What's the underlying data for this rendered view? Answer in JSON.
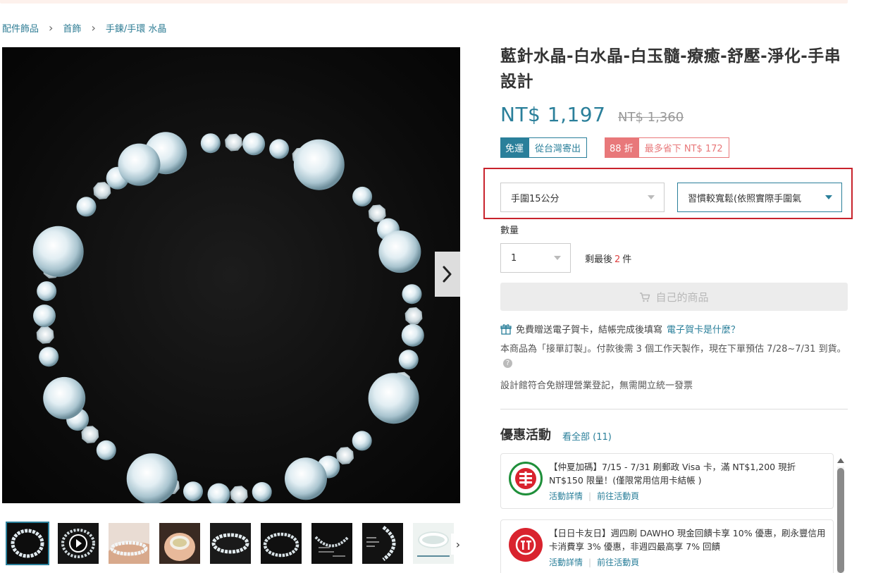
{
  "breadcrumb": [
    "配件飾品",
    "首飾",
    "手鍊/手環 水晶"
  ],
  "product": {
    "title": "藍針水晶-白水晶-白玉髓-療癒-舒壓-淨化-手串設計",
    "price": "NT$ 1,197",
    "original_price": "NT$ 1,360"
  },
  "tags": {
    "shipping_a": "免運",
    "shipping_b": "從台灣寄出",
    "discount_a": "88 折",
    "discount_b": "最多省下 NT$ 172"
  },
  "variants": {
    "size": "手圍15公分",
    "fit": "習慣較寬鬆(依照實際手圍氣"
  },
  "quantity": {
    "label": "數量",
    "value": "1",
    "stock_prefix": "剩最後",
    "stock_count": "2",
    "stock_suffix": "件"
  },
  "buy_button": "自己的商品",
  "gift": {
    "text": "免費贈送電子賀卡，結帳完成後填寫",
    "link": "電子賀卡是什麼？"
  },
  "notes": {
    "made_to_order": "本商品為「接單訂製」。付款後需 3 個工作天製作，現在下單預估 7/28~7/31 到貨。",
    "invoice": "設計館符合免辦理營業登記，無需開立統一發票"
  },
  "promotions": {
    "title": "優惠活動",
    "view_all": "看全部 (11)",
    "items": [
      {
        "text": "【仲夏加碼】7/15 - 7/31 刷郵政 Visa 卡，滿 NT$1,200 現折 NT$150 限量！(僅限常用信用卡結帳 )",
        "detail": "活動詳情",
        "go": "前往活動頁",
        "logo": "post-bank-logo",
        "color": "#1f8f3a"
      },
      {
        "text": "【日日卡友日】週四刷 DAWHO 現金回饋卡享 10% 優惠，刷永豐信用卡消費享 3% 優惠，非週四最高享 7% 回饋",
        "detail": "活動詳情",
        "go": "前往活動頁",
        "logo": "sinopac-logo",
        "color": "#d9232e"
      }
    ]
  },
  "colors": {
    "accent": "#2a7f9a",
    "discount": "#e8787a",
    "highlight_border": "#c8232c"
  }
}
